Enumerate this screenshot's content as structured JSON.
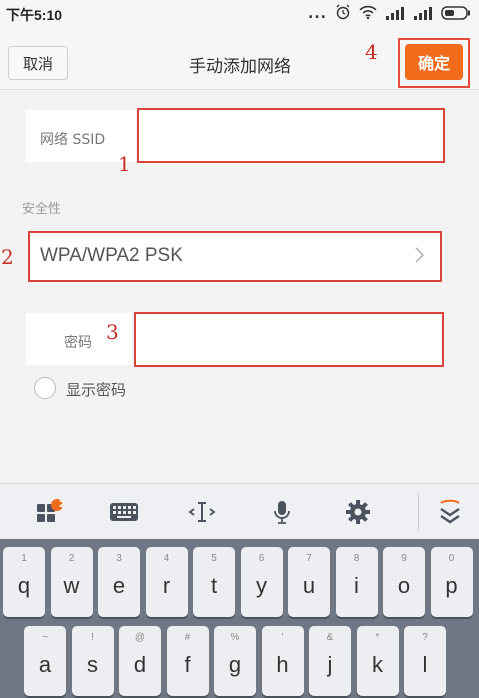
{
  "status_bar": {
    "time": "下午5:10",
    "dots": "..."
  },
  "header": {
    "cancel_label": "取消",
    "title": "手动添加网络",
    "confirm_label": "确定"
  },
  "annotations": {
    "ssid": "1",
    "security": "2",
    "password": "3",
    "confirm": "4"
  },
  "form": {
    "ssid_label": "网络 SSID",
    "ssid_value": "",
    "security_section": "安全性",
    "security_value": "WPA/WPA2 PSK",
    "password_label": "密码",
    "password_value": "",
    "show_password_label": "显示密码"
  },
  "keyboard": {
    "toolbar_icons": [
      "apps-icon",
      "keyboard-icon",
      "cursor-icon",
      "microphone-icon",
      "gear-icon",
      "collapse-keyboard-icon"
    ],
    "apps_badge": "2",
    "row1": [
      {
        "key": "q",
        "hint": "1"
      },
      {
        "key": "w",
        "hint": "2"
      },
      {
        "key": "e",
        "hint": "3"
      },
      {
        "key": "r",
        "hint": "4"
      },
      {
        "key": "t",
        "hint": "5"
      },
      {
        "key": "y",
        "hint": "6"
      },
      {
        "key": "u",
        "hint": "7"
      },
      {
        "key": "i",
        "hint": "8"
      },
      {
        "key": "o",
        "hint": "9"
      },
      {
        "key": "p",
        "hint": "0"
      }
    ],
    "row2": [
      {
        "key": "a",
        "hint": "~"
      },
      {
        "key": "s",
        "hint": "!"
      },
      {
        "key": "d",
        "hint": "@"
      },
      {
        "key": "f",
        "hint": "#"
      },
      {
        "key": "g",
        "hint": "%"
      },
      {
        "key": "h",
        "hint": "'"
      },
      {
        "key": "j",
        "hint": "&"
      },
      {
        "key": "k",
        "hint": "*"
      },
      {
        "key": "l",
        "hint": "?"
      }
    ]
  },
  "colors": {
    "accent": "#f26a1b",
    "annotation": "#d9433a",
    "keyboard_bg": "#6f7784"
  }
}
